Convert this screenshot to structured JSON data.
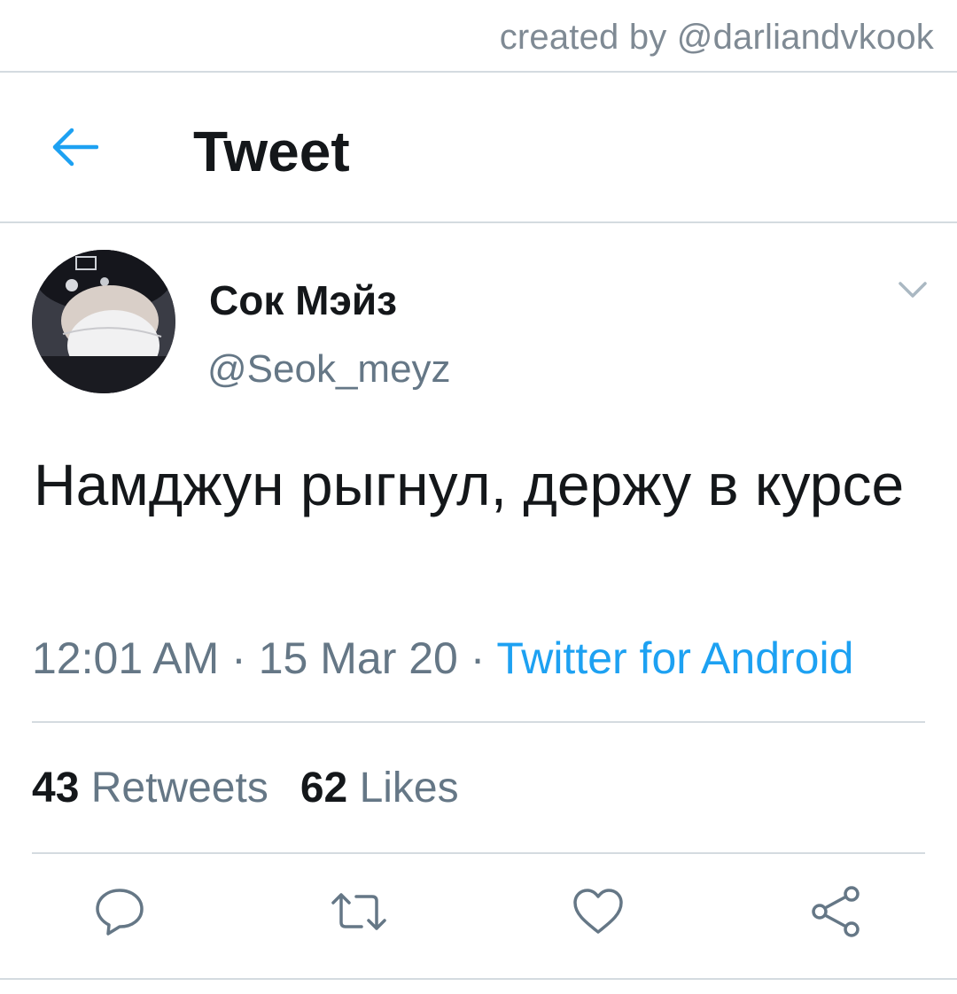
{
  "watermark": "created by @darliandvkook",
  "header": {
    "title": "Tweet"
  },
  "tweet": {
    "display_name": "Сок Мэйз",
    "handle": "@Seok_meyz",
    "text": "Намджун рыгнул, держу в курсе",
    "time": "12:01 AM",
    "date": "15 Mar 20",
    "separator": "·",
    "source": "Twitter for Android",
    "retweets_count": "43",
    "retweets_label": "Retweets",
    "likes_count": "62",
    "likes_label": "Likes"
  },
  "icons": {
    "back": "arrow-left-icon",
    "more": "chevron-down-icon",
    "reply": "reply-icon",
    "retweet": "retweet-icon",
    "like": "heart-icon",
    "share": "share-icon"
  },
  "colors": {
    "accent": "#1da1f2",
    "text_primary": "#14171a",
    "text_secondary": "#657786",
    "divider": "#d4dbe0"
  }
}
